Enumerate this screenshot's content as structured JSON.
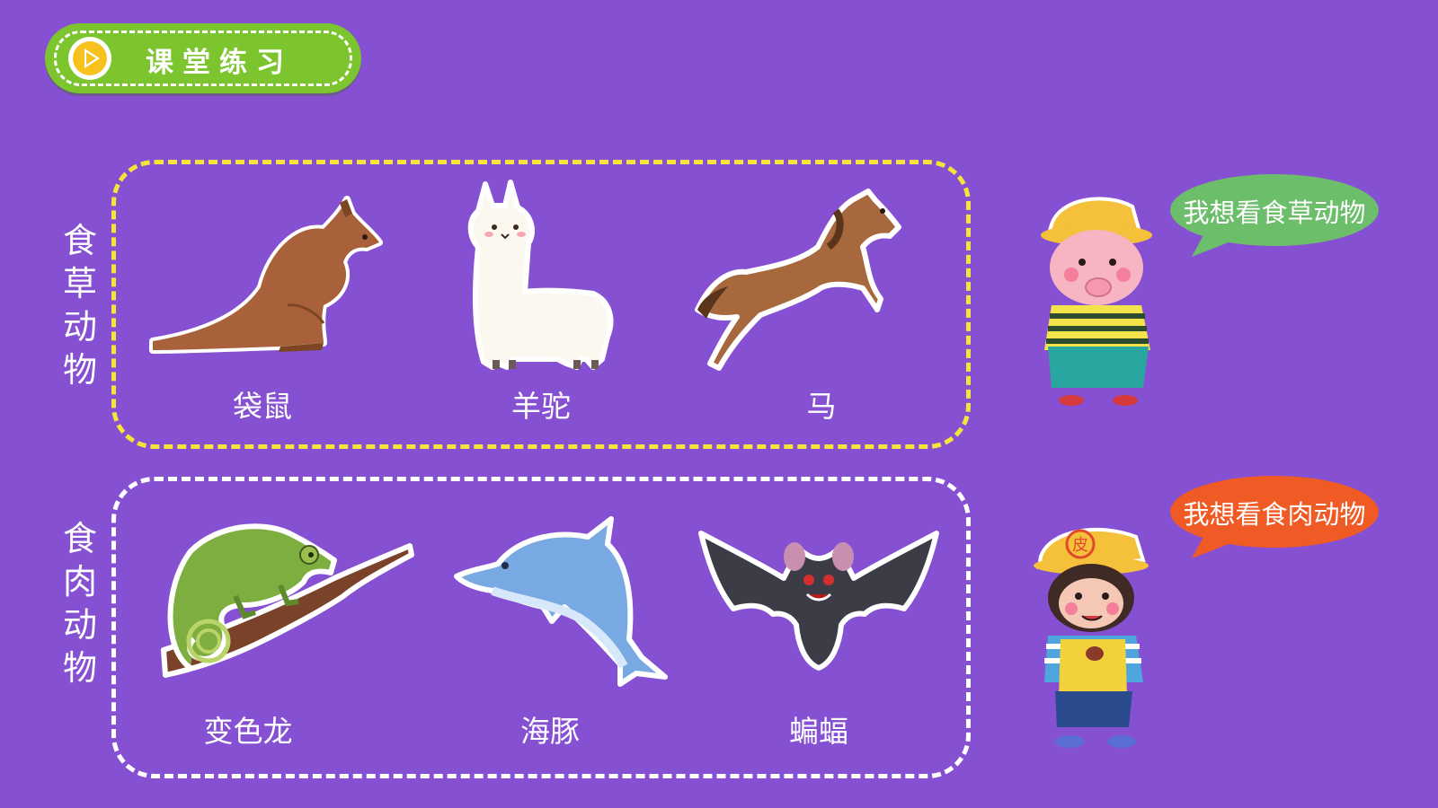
{
  "header": {
    "title": "课堂练习",
    "play_icon": "play-icon"
  },
  "groups": {
    "herbivores": {
      "label": "食草动物",
      "label_chars": [
        "食",
        "草",
        "动",
        "物"
      ],
      "border_color": "#f6e43b",
      "animals": [
        {
          "name": "袋鼠",
          "icon": "kangaroo-illustration"
        },
        {
          "name": "羊驼",
          "icon": "alpaca-illustration"
        },
        {
          "name": "马",
          "icon": "horse-illustration"
        }
      ]
    },
    "carnivores": {
      "label": "食肉动物",
      "label_chars": [
        "食",
        "肉",
        "动",
        "物"
      ],
      "border_color": "#ffffff",
      "animals": [
        {
          "name": "变色龙",
          "icon": "chameleon-illustration"
        },
        {
          "name": "海豚",
          "icon": "dolphin-illustration"
        },
        {
          "name": "蝙蝠",
          "icon": "bat-illustration"
        }
      ]
    }
  },
  "speech": {
    "pig": {
      "text": "我想看食草动物",
      "color": "#6dbe6a",
      "character": "pig-character"
    },
    "monkey": {
      "text": "我想看食肉动物",
      "color": "#f05a24",
      "character": "monkey-character",
      "cap_text": "皮"
    }
  },
  "colors": {
    "background": "#8650d3",
    "title_pill": "#7cc52e"
  }
}
